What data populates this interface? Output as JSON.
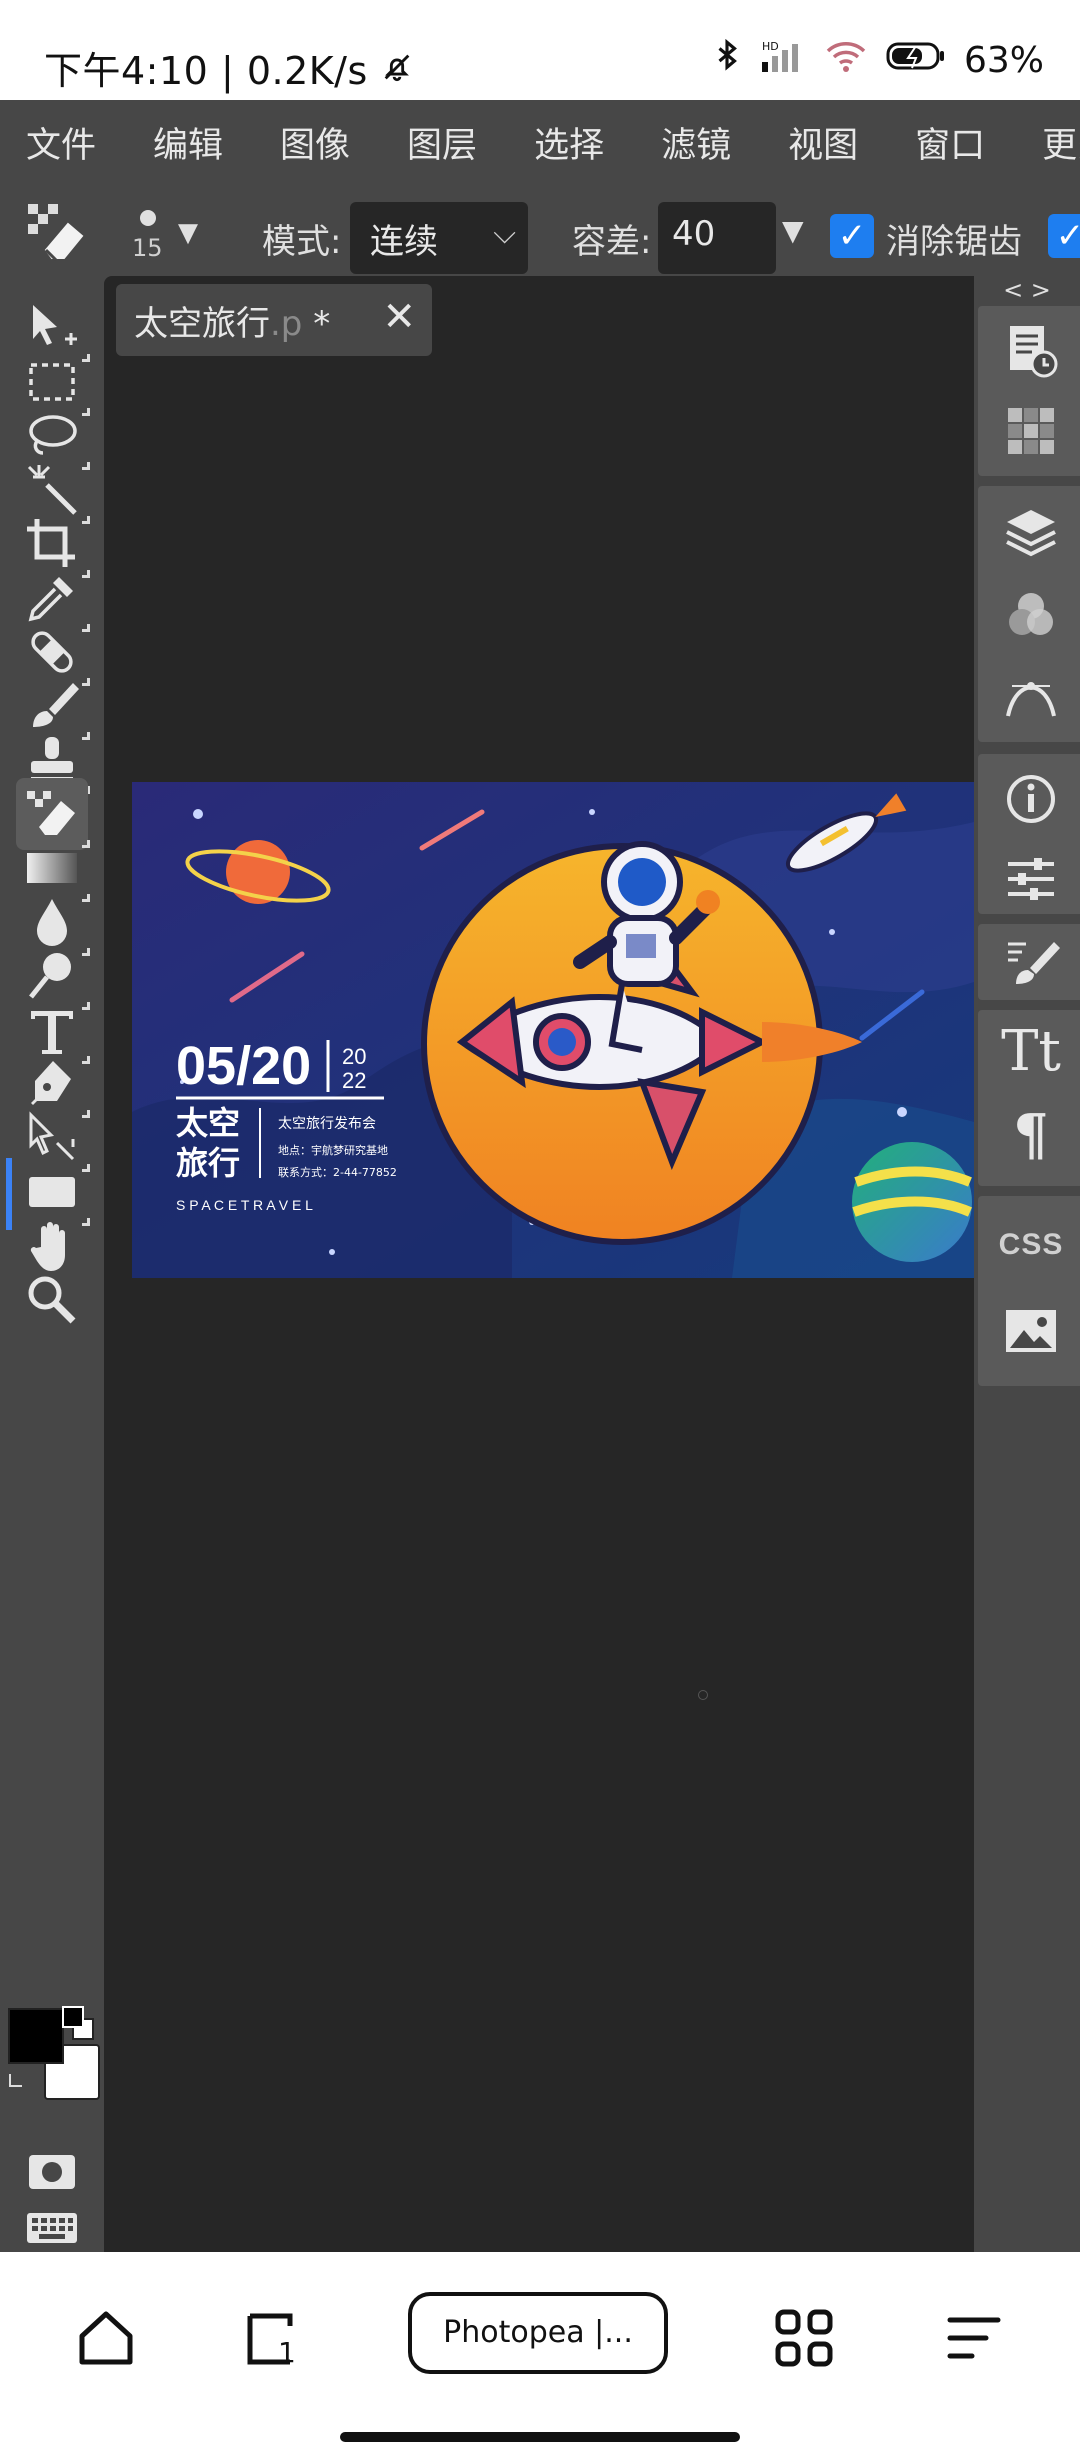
{
  "status": {
    "time": "下午4:10",
    "net_speed": "0.2K/s",
    "battery": "63%"
  },
  "menu": [
    "文件",
    "编辑",
    "图像",
    "图层",
    "选择",
    "滤镜",
    "视图",
    "窗口",
    "更多"
  ],
  "options": {
    "brush_size": "15",
    "mode_label": "模式:",
    "mode_value": "连续",
    "tolerance_label": "容差:",
    "tolerance_value": "40",
    "antialias_label": "消除锯齿"
  },
  "document": {
    "tab_name": "太空旅行",
    "tab_ext": ".p",
    "tab_modified": " *"
  },
  "artwork": {
    "date": "05/20",
    "year_top": "20",
    "year_bottom": "22",
    "title_line1": "太空",
    "title_line2": "旅行",
    "event": "太空旅行发布会",
    "location": "地点：宇航梦研究基地",
    "contact": "联系方式：2-44-77852",
    "tagline": "S P A C E   T R A V E L"
  },
  "panel_toggle": "< >",
  "right_panel": {
    "css_label": "CSS",
    "type_label": "Tt",
    "para_label": "¶"
  },
  "bottom_nav": {
    "tab_title": "Photopea |..."
  },
  "colors": {
    "app_bg": "#474747",
    "canvas_bg": "#262626",
    "accent": "#1e7ef0",
    "foreground": "#000000",
    "background": "#ffffff"
  }
}
